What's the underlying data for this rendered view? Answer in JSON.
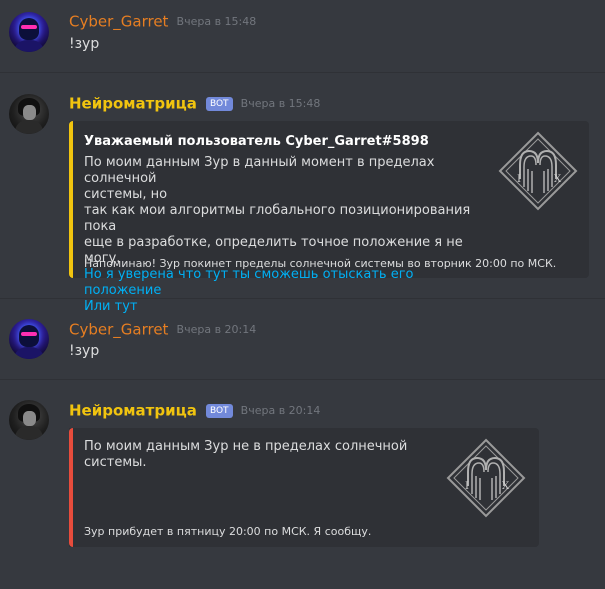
{
  "messages": [
    {
      "author": "Cyber_Garret",
      "timestamp": "Вчера в 15:48",
      "text": "!зур"
    },
    {
      "author": "Нейроматрица",
      "bot_tag": "BOT",
      "timestamp": "Вчера в 15:48",
      "embed": {
        "title": "Уважаемый пользователь Cyber_Garret#5898",
        "lines": [
          "По моим данным Зур в данный момент в пределах солнечной",
          "системы, но",
          "так как мои алгоритмы глобального позиционирования пока",
          "еще в разработке, определить точное положение я не могу."
        ],
        "link1": "Но я уверена что тут ты сможешь отыскать его положение",
        "link2": "Или тут",
        "footer": "Напоминаю! Зур покинет пределы солнечной системы во вторник 20:00 по МСК.",
        "accent": "#f1c40f",
        "thumb_letters": [
          "I",
          "X"
        ]
      }
    },
    {
      "author": "Cyber_Garret",
      "timestamp": "Вчера в 20:14",
      "text": "!зур"
    },
    {
      "author": "Нейроматрица",
      "bot_tag": "BOT",
      "timestamp": "Вчера в 20:14",
      "embed": {
        "description": "По моим данным Зур не в пределах солнечной системы.",
        "footer": "Зур прибудет в пятницу 20:00 по МСК. Я сообщу.",
        "accent": "#e74c3c",
        "thumb_letters": [
          "I",
          "X"
        ]
      }
    }
  ],
  "colors": {
    "background": "#36393f",
    "embed_bg": "#2f3136",
    "cyber_name": "#e67e22",
    "bot_name": "#f1c40f",
    "bot_tag": "#7289da",
    "link": "#00b0f4",
    "timestamp": "#72767d"
  }
}
